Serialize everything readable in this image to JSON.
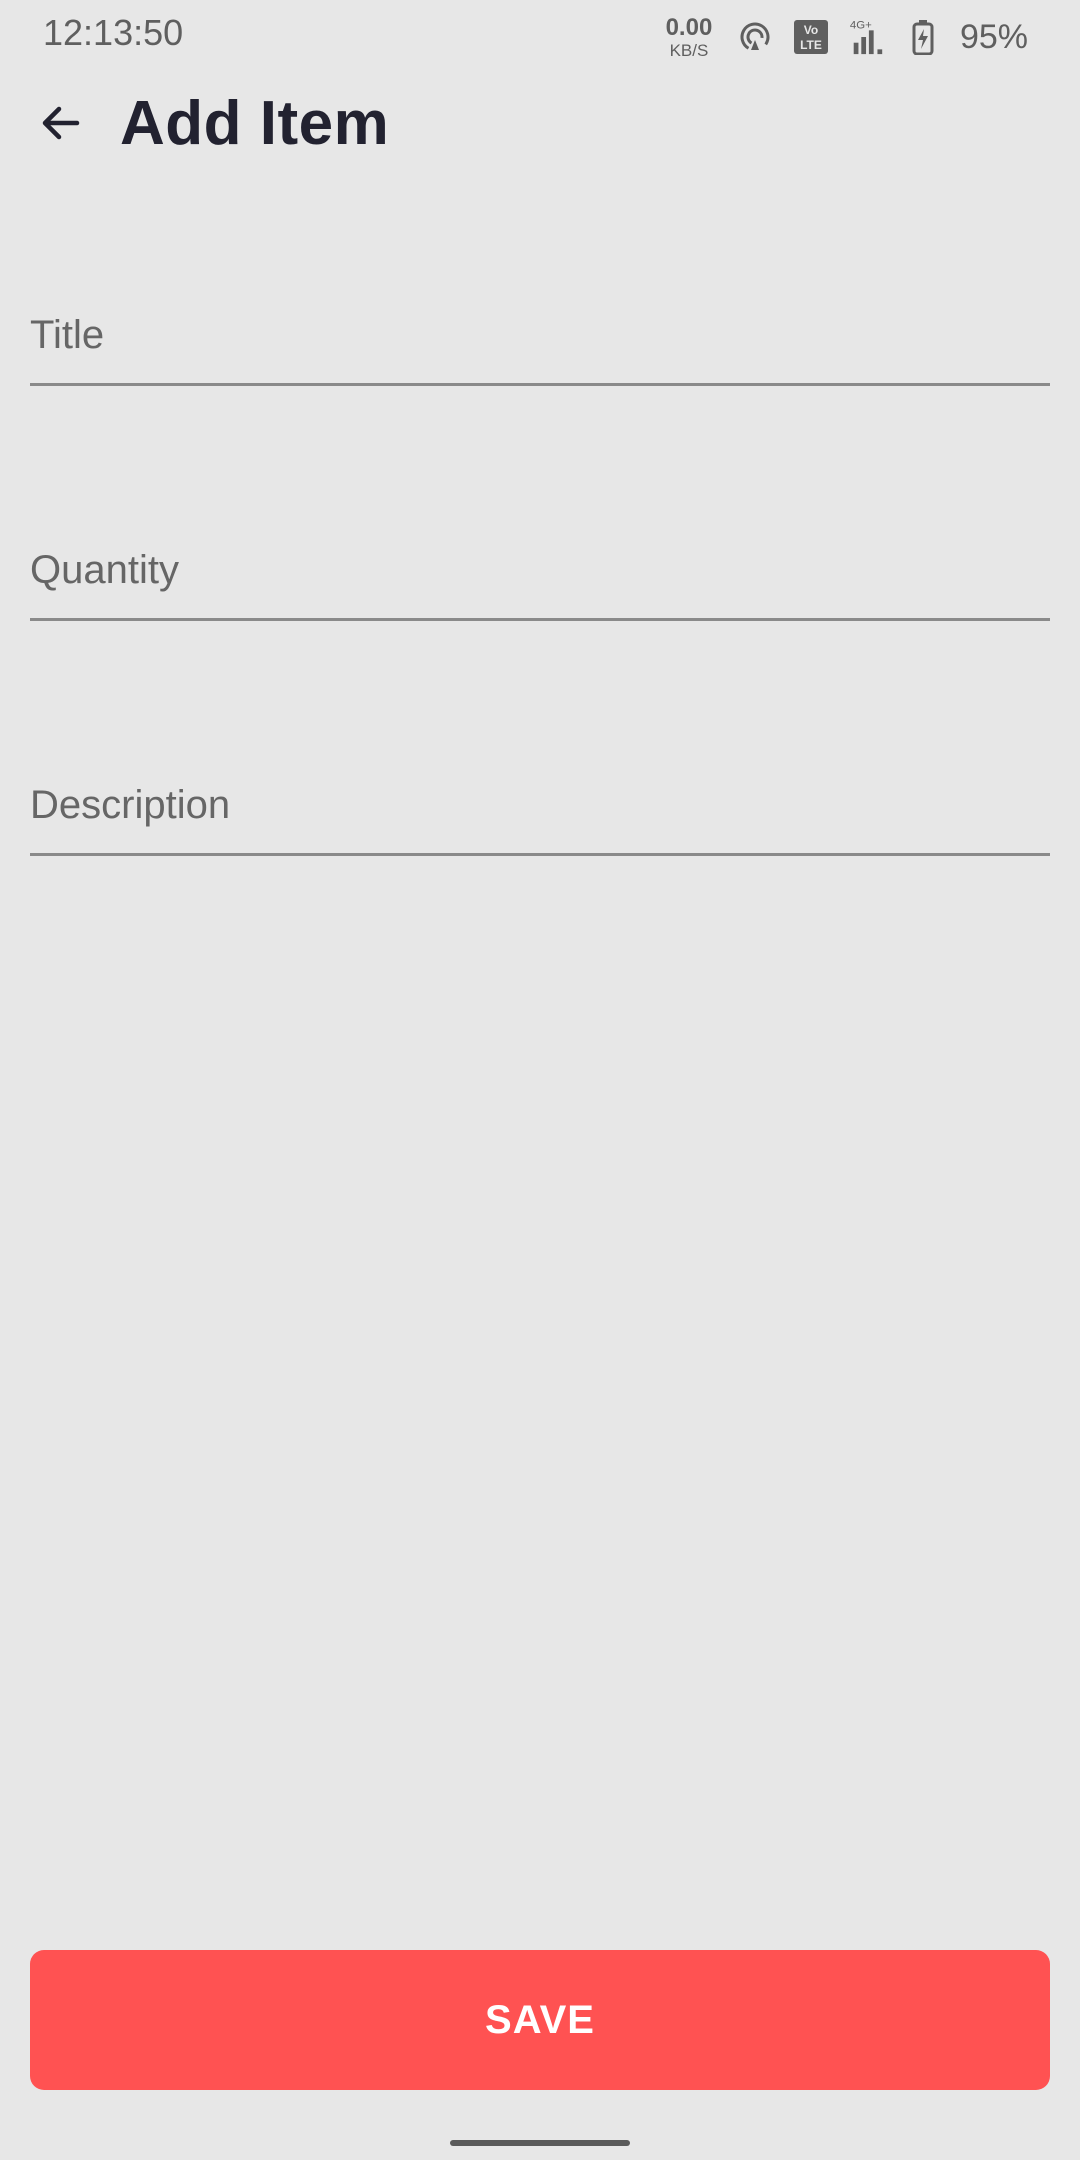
{
  "status_bar": {
    "time": "12:13:50",
    "net_speed_value": "0.00",
    "net_speed_unit": "KB/S",
    "volte_label": "Vo LTE",
    "network_label": "4G+",
    "battery_percent": "95%",
    "icons": [
      "hotspot-icon",
      "volte-icon",
      "signal-icon",
      "battery-charging-icon"
    ]
  },
  "app_bar": {
    "title": "Add Item",
    "back_icon": "arrow-left-icon"
  },
  "form": {
    "title_placeholder": "Title",
    "title_value": "",
    "quantity_placeholder": "Quantity",
    "quantity_value": "",
    "description_placeholder": "Description",
    "description_value": ""
  },
  "actions": {
    "save_label": "SAVE"
  },
  "colors": {
    "background": "#e7e7e7",
    "accent": "#ff5252",
    "title_text": "#222230",
    "field_underline": "#8a8a8a"
  }
}
